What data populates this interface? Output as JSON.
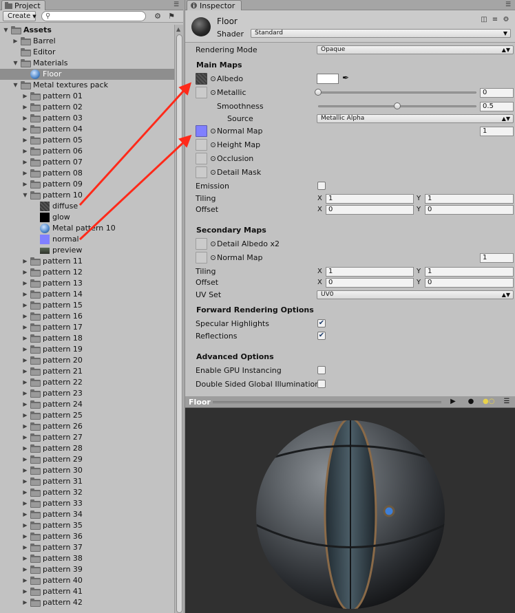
{
  "project": {
    "tab_label": "Project",
    "create_label": "Create",
    "search_placeholder": "",
    "tree": [
      {
        "label": "Assets",
        "level": 0,
        "kind": "folder",
        "expanded": true,
        "bold": true
      },
      {
        "label": "Barrel",
        "level": 1,
        "kind": "folder",
        "expanded": false
      },
      {
        "label": "Editor",
        "level": 1,
        "kind": "folder",
        "leaf": true
      },
      {
        "label": "Materials",
        "level": 1,
        "kind": "folder",
        "expanded": true
      },
      {
        "label": "Floor",
        "level": 2,
        "kind": "material",
        "selected": true
      },
      {
        "label": "Metal textures pack",
        "level": 1,
        "kind": "folder",
        "expanded": true
      },
      {
        "label": "pattern 01",
        "level": 2,
        "kind": "folder",
        "expanded": false
      },
      {
        "label": "pattern 02",
        "level": 2,
        "kind": "folder",
        "expanded": false
      },
      {
        "label": "pattern 03",
        "level": 2,
        "kind": "folder",
        "expanded": false
      },
      {
        "label": "pattern 04",
        "level": 2,
        "kind": "folder",
        "expanded": false
      },
      {
        "label": "pattern 05",
        "level": 2,
        "kind": "folder",
        "expanded": false
      },
      {
        "label": "pattern 06",
        "level": 2,
        "kind": "folder",
        "expanded": false
      },
      {
        "label": "pattern 07",
        "level": 2,
        "kind": "folder",
        "expanded": false
      },
      {
        "label": "pattern 08",
        "level": 2,
        "kind": "folder",
        "expanded": false
      },
      {
        "label": "pattern 09",
        "level": 2,
        "kind": "folder",
        "expanded": false
      },
      {
        "label": "pattern 10",
        "level": 2,
        "kind": "folder",
        "expanded": true
      },
      {
        "label": "diffuse",
        "level": 3,
        "kind": "tex-diffuse"
      },
      {
        "label": "glow",
        "level": 3,
        "kind": "tex-glow"
      },
      {
        "label": "Metal pattern 10",
        "level": 3,
        "kind": "material"
      },
      {
        "label": "normal",
        "level": 3,
        "kind": "tex-normal"
      },
      {
        "label": "preview",
        "level": 3,
        "kind": "tex-preview"
      },
      {
        "label": "pattern 11",
        "level": 2,
        "kind": "folder",
        "expanded": false
      },
      {
        "label": "pattern 12",
        "level": 2,
        "kind": "folder",
        "expanded": false
      },
      {
        "label": "pattern 13",
        "level": 2,
        "kind": "folder",
        "expanded": false
      },
      {
        "label": "pattern 14",
        "level": 2,
        "kind": "folder",
        "expanded": false
      },
      {
        "label": "pattern 15",
        "level": 2,
        "kind": "folder",
        "expanded": false
      },
      {
        "label": "pattern 16",
        "level": 2,
        "kind": "folder",
        "expanded": false
      },
      {
        "label": "pattern 17",
        "level": 2,
        "kind": "folder",
        "expanded": false
      },
      {
        "label": "pattern 18",
        "level": 2,
        "kind": "folder",
        "expanded": false
      },
      {
        "label": "pattern 19",
        "level": 2,
        "kind": "folder",
        "expanded": false
      },
      {
        "label": "pattern 20",
        "level": 2,
        "kind": "folder",
        "expanded": false
      },
      {
        "label": "pattern 21",
        "level": 2,
        "kind": "folder",
        "expanded": false
      },
      {
        "label": "pattern 22",
        "level": 2,
        "kind": "folder",
        "expanded": false
      },
      {
        "label": "pattern 23",
        "level": 2,
        "kind": "folder",
        "expanded": false
      },
      {
        "label": "pattern 24",
        "level": 2,
        "kind": "folder",
        "expanded": false
      },
      {
        "label": "pattern 25",
        "level": 2,
        "kind": "folder",
        "expanded": false
      },
      {
        "label": "pattern 26",
        "level": 2,
        "kind": "folder",
        "expanded": false
      },
      {
        "label": "pattern 27",
        "level": 2,
        "kind": "folder",
        "expanded": false
      },
      {
        "label": "pattern 28",
        "level": 2,
        "kind": "folder",
        "expanded": false
      },
      {
        "label": "pattern 29",
        "level": 2,
        "kind": "folder",
        "expanded": false
      },
      {
        "label": "pattern 30",
        "level": 2,
        "kind": "folder",
        "expanded": false
      },
      {
        "label": "pattern 31",
        "level": 2,
        "kind": "folder",
        "expanded": false
      },
      {
        "label": "pattern 32",
        "level": 2,
        "kind": "folder",
        "expanded": false
      },
      {
        "label": "pattern 33",
        "level": 2,
        "kind": "folder",
        "expanded": false
      },
      {
        "label": "pattern 34",
        "level": 2,
        "kind": "folder",
        "expanded": false
      },
      {
        "label": "pattern 35",
        "level": 2,
        "kind": "folder",
        "expanded": false
      },
      {
        "label": "pattern 36",
        "level": 2,
        "kind": "folder",
        "expanded": false
      },
      {
        "label": "pattern 37",
        "level": 2,
        "kind": "folder",
        "expanded": false
      },
      {
        "label": "pattern 38",
        "level": 2,
        "kind": "folder",
        "expanded": false
      },
      {
        "label": "pattern 39",
        "level": 2,
        "kind": "folder",
        "expanded": false
      },
      {
        "label": "pattern 40",
        "level": 2,
        "kind": "folder",
        "expanded": false
      },
      {
        "label": "pattern 41",
        "level": 2,
        "kind": "folder",
        "expanded": false
      },
      {
        "label": "pattern 42",
        "level": 2,
        "kind": "folder",
        "expanded": false
      }
    ]
  },
  "inspector": {
    "tab_label": "Inspector",
    "material_name": "Floor",
    "shader_label": "Shader",
    "shader_value": "Standard",
    "rendering_mode_label": "Rendering Mode",
    "rendering_mode_value": "Opaque",
    "main_maps_header": "Main Maps",
    "albedo_label": "Albedo",
    "albedo_color": "#ffffff",
    "metallic_label": "Metallic",
    "metallic_value": "0",
    "metallic_fraction": 0,
    "smoothness_label": "Smoothness",
    "smoothness_value": "0.5",
    "smoothness_fraction": 0.5,
    "source_label": "Source",
    "source_value": "Metallic Alpha",
    "normal_map_label": "Normal Map",
    "normal_map_scale": "1",
    "height_map_label": "Height Map",
    "occlusion_label": "Occlusion",
    "detail_mask_label": "Detail Mask",
    "emission_label": "Emission",
    "emission_checked": false,
    "tiling_label": "Tiling",
    "tiling_x": "1",
    "tiling_y": "1",
    "offset_label": "Offset",
    "offset_x": "0",
    "offset_y": "0",
    "x_label": "X",
    "y_label": "Y",
    "secondary_maps_header": "Secondary Maps",
    "detail_albedo_label": "Detail Albedo x2",
    "secondary_normal_map_label": "Normal Map",
    "secondary_normal_scale": "1",
    "secondary_tiling_x": "1",
    "secondary_tiling_y": "1",
    "secondary_offset_x": "0",
    "secondary_offset_y": "0",
    "uv_set_label": "UV Set",
    "uv_set_value": "UV0",
    "forward_header": "Forward Rendering Options",
    "specular_label": "Specular Highlights",
    "specular_checked": true,
    "reflections_label": "Reflections",
    "reflections_checked": true,
    "advanced_header": "Advanced Options",
    "gpu_instancing_label": "Enable GPU Instancing",
    "gpu_instancing_checked": false,
    "double_sided_gi_label": "Double Sided Global Illumination",
    "double_sided_gi_checked": false
  },
  "preview": {
    "title": "Floor"
  },
  "colors": {
    "panel_bg": "#c2c2c2",
    "selection": "#8e8e8e",
    "normal_map": "#8080ff",
    "annotation_arrow": "#ff2a1a",
    "preview_bg": "#303030"
  }
}
